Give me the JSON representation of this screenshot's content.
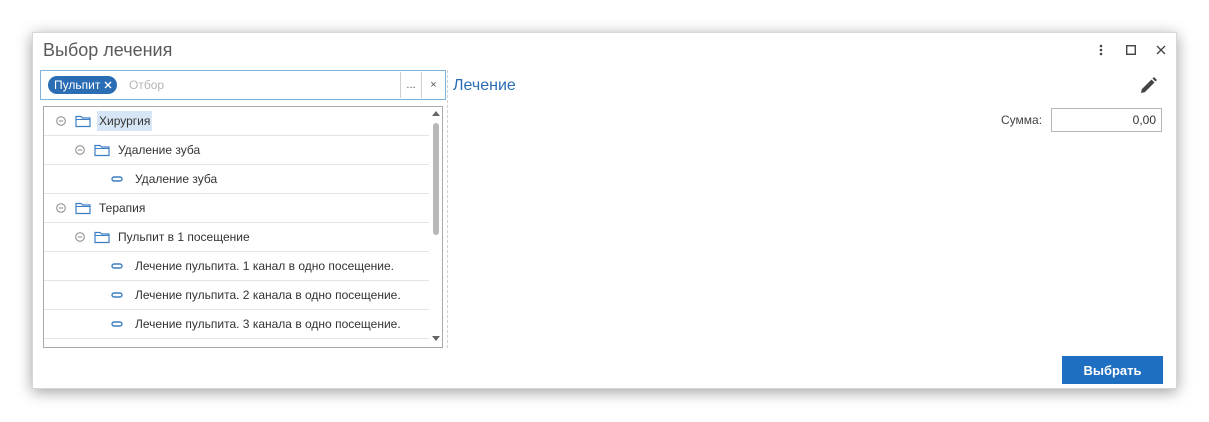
{
  "window": {
    "title": "Выбор лечения"
  },
  "filter": {
    "chip_label": "Пульпит",
    "placeholder": "Отбор",
    "more_label": "...",
    "clear_label": "×"
  },
  "tree": {
    "items": [
      {
        "label": "Хирургия",
        "level": 0,
        "type": "folder",
        "expanded": true,
        "selected": true
      },
      {
        "label": "Удаление зуба",
        "level": 1,
        "type": "folder",
        "expanded": true
      },
      {
        "label": "Удаление зуба",
        "level": 2,
        "type": "item"
      },
      {
        "label": "Терапия",
        "level": 0,
        "type": "folder",
        "expanded": true
      },
      {
        "label": "Пульпит в 1 посещение",
        "level": 1,
        "type": "folder",
        "expanded": true
      },
      {
        "label": "Лечение пульпита. 1 канал в одно посещение.",
        "level": 2,
        "type": "item"
      },
      {
        "label": "Лечение пульпита. 2 канала в одно посещение.",
        "level": 2,
        "type": "item"
      },
      {
        "label": "Лечение пульпита. 3 канала в одно посещение.",
        "level": 2,
        "type": "item"
      }
    ]
  },
  "right_panel": {
    "title": "Лечение",
    "sum_label": "Сумма:",
    "sum_value": "0,00"
  },
  "footer": {
    "select_label": "Выбрать"
  },
  "colors": {
    "accent": "#2a6db5",
    "button": "#1e6fc2",
    "selection": "#d6e6f6"
  }
}
